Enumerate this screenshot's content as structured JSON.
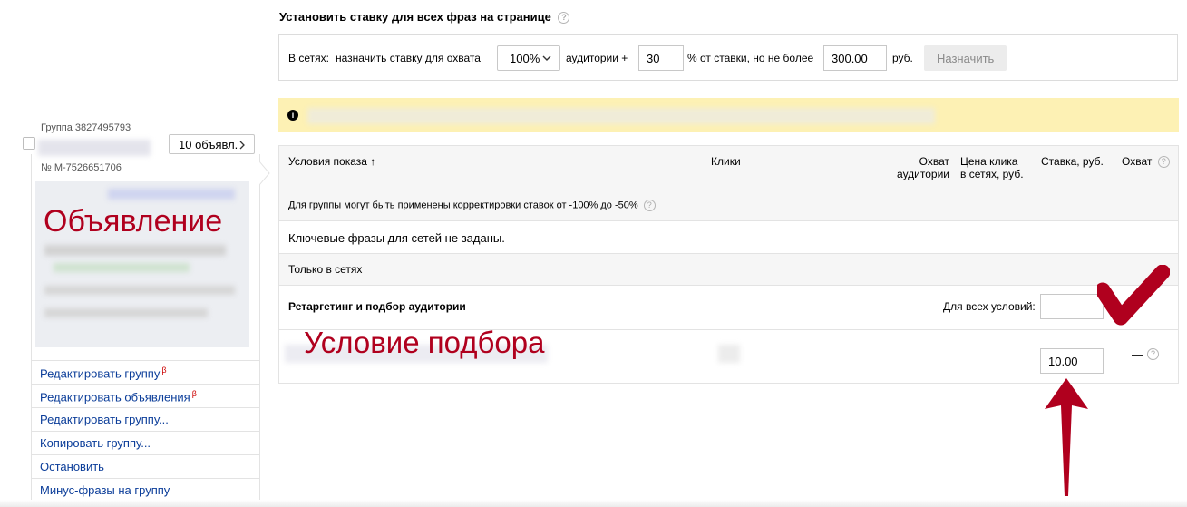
{
  "header": {
    "title": "Установить ставку для всех фраз на странице"
  },
  "bid_bar": {
    "prefix": "В сетях:",
    "assign_label": "назначить ставку для охвата",
    "coverage_value": "100%",
    "audience_label": "аудитории +",
    "percent_value": "30",
    "percent_label": "% от ставки, но не более",
    "max_value": "300.00",
    "currency": "руб.",
    "apply_button": "Назначить"
  },
  "group": {
    "label": "Группа 3827495793",
    "ads_button": "10 объявл.",
    "ad_number": "№ M-7526651706",
    "ad_overlay": "Объявление"
  },
  "sidebar_links": [
    {
      "label": "Редактировать группу",
      "beta": "β"
    },
    {
      "label": "Редактировать объявления",
      "beta": "β"
    },
    {
      "label": "Редактировать группу...",
      "beta": ""
    },
    {
      "label": "Копировать группу...",
      "beta": ""
    },
    {
      "label": "Остановить",
      "beta": ""
    },
    {
      "label": "Минус-фразы на группу",
      "beta": ""
    }
  ],
  "table": {
    "columns": {
      "conditions": "Условия показа ↑",
      "clicks": "Клики",
      "coverage_1": "Охват",
      "coverage_2": "аудитории",
      "price_1": "Цена клика",
      "price_2": "в сетях, руб.",
      "bid": "Ставка, руб.",
      "reach": "Охват"
    },
    "adjustment_note": "Для группы могут быть применены корректировки ставок от -100% до -50%",
    "no_keywords": "Ключевые фразы для сетей не заданы.",
    "only_networks": "Только в сетях",
    "retargeting_title": "Ретаргетинг и подбор аудитории",
    "all_conditions_label": "Для всех условий:",
    "all_conditions_value": "",
    "condition_overlay": "Условие подбора",
    "condition_bid": "10.00",
    "condition_reach": "—"
  },
  "colors": {
    "annotation_red": "#b0001e",
    "notice_yellow": "#fdf1b4",
    "link_blue": "#0b3d99"
  }
}
